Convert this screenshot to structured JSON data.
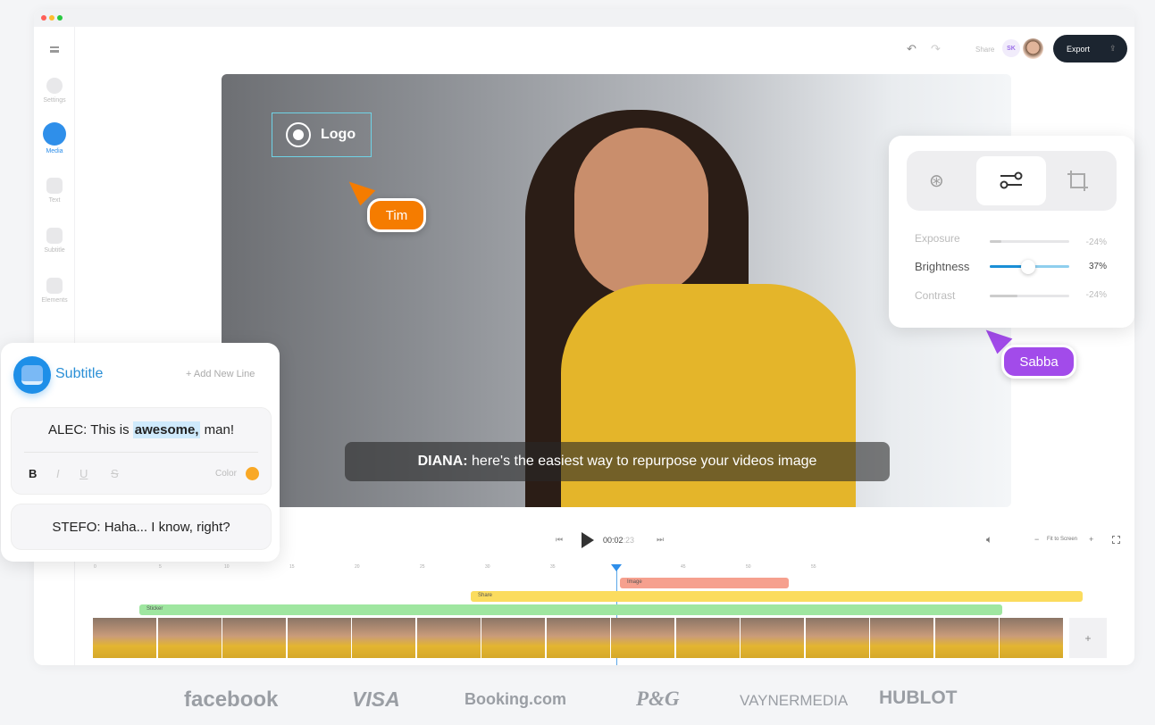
{
  "window": {
    "dots": [
      "#ff5f57",
      "#febc2e",
      "#28c840"
    ]
  },
  "sidebar": {
    "menu_icon": "hamburger-icon",
    "items": [
      {
        "label": "Settings",
        "icon": "gear-icon"
      },
      {
        "label": "Media",
        "icon": "image-icon",
        "active": true
      },
      {
        "label": "Text",
        "icon": "text-icon"
      },
      {
        "label": "Subtitle",
        "icon": "subtitle-icon"
      },
      {
        "label": "Elements",
        "icon": "elements-icon"
      }
    ]
  },
  "header": {
    "share_label": "Share",
    "user_initials": "SK",
    "export_label": "Export"
  },
  "video": {
    "logo_label": "Logo",
    "caption_speaker": "DIANA:",
    "caption_text": " here's the easiest way to repurpose your videos image"
  },
  "cursors": [
    {
      "name": "Tim",
      "color": "#f57c00"
    },
    {
      "name": "Sabba",
      "color": "#a24bea"
    }
  ],
  "adjust_panel": {
    "tabs": [
      "color-filter-icon",
      "sliders-icon",
      "crop-icon"
    ],
    "active_tab": 1,
    "sliders": [
      {
        "label": "Exposure",
        "value": "-24%",
        "level": 0.15
      },
      {
        "label": "Brightness",
        "value": "37%",
        "level": 0.48,
        "active": true
      },
      {
        "label": "Contrast",
        "value": "-24%",
        "level": 0.35
      }
    ]
  },
  "subtitle_panel": {
    "title": "Subtitle",
    "add_line": "+ Add New Line",
    "line1_pre": "ALEC: This is ",
    "line1_highlight": "awesome,",
    "line1_post": " man!",
    "format": {
      "bold": "B",
      "italic": "I",
      "underline": "U",
      "strike": "S",
      "color_label": "Color",
      "color": "#f9a825"
    },
    "line2": "STEFO: Haha... I know, right?"
  },
  "player": {
    "time_main": "00:02",
    "time_frac": ":23",
    "zoom_label": "Fit to Screen",
    "zoom_minus": "−",
    "zoom_plus": "+"
  },
  "timeline": {
    "ticks": [
      "0",
      "5",
      "10",
      "15",
      "20",
      "25",
      "30",
      "35",
      "45",
      "50",
      "55"
    ],
    "tracks": [
      {
        "label": "Image",
        "color": "#f6a08e"
      },
      {
        "label": "Share",
        "color": "#fbdc5e"
      },
      {
        "label": "Sticker",
        "color": "#9fe6a0"
      }
    ],
    "add_label": "+"
  },
  "brands": [
    "facebook",
    "VISA",
    "Booking.com",
    "P&G",
    "VAYNERMEDIA",
    "HUBLOT"
  ]
}
